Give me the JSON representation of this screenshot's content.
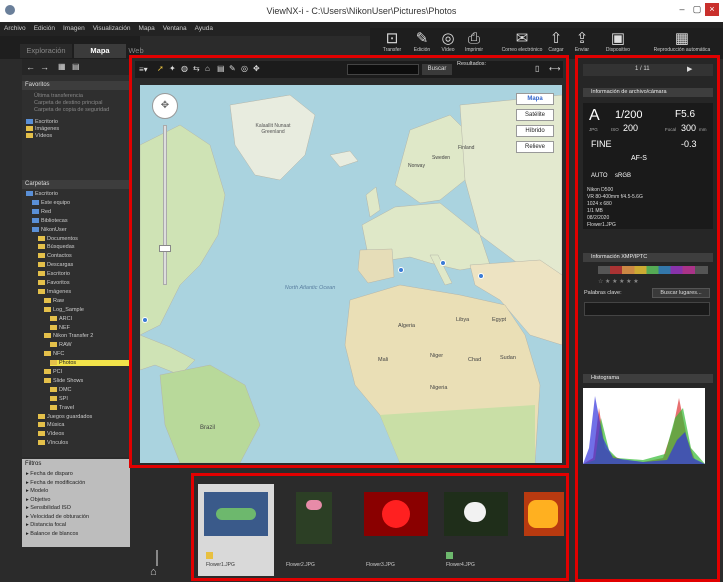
{
  "titlebar": {
    "title": "ViewNX-i - C:\\Users\\NikonUser\\Pictures\\Photos",
    "min": "–",
    "max": "▢",
    "close": "×"
  },
  "menu": [
    "Archivo",
    "Edición",
    "Imagen",
    "Visualización",
    "Mapa",
    "Ventana",
    "Ayuda"
  ],
  "tabs": {
    "explore": "Exploración",
    "map": "Mapa",
    "web": "Web"
  },
  "toolbar": [
    {
      "label": "Transfer",
      "icon": "camera-transfer-icon",
      "glyph": "⊡"
    },
    {
      "label": "Edición",
      "icon": "edit-icon",
      "glyph": "✎"
    },
    {
      "label": "Vídeo",
      "icon": "video-icon",
      "glyph": "◎"
    },
    {
      "label": "Imprimir",
      "icon": "print-icon",
      "glyph": "⎙"
    },
    {
      "label": "Correo electrónico",
      "icon": "mail-icon",
      "glyph": "✉"
    },
    {
      "label": "Cargar",
      "icon": "upload-icon",
      "glyph": "⇧"
    },
    {
      "label": "Enviar",
      "icon": "send-icon",
      "glyph": "⇪"
    },
    {
      "label": "Dispositivo",
      "icon": "device-icon",
      "glyph": "▣"
    },
    {
      "label": "Reproducción automática",
      "icon": "slideshow-icon",
      "glyph": "▦"
    }
  ],
  "left": {
    "favorites_header": "Favoritos",
    "favorites": [
      "Última transferencia",
      "Carpeta de destino principal",
      "Carpeta de copia de seguridad"
    ],
    "favorites2": [
      "Escritorio",
      "Imágenes",
      "Vídeos"
    ],
    "folders_header": "Carpetas",
    "folders": [
      {
        "label": "Escritorio",
        "indent": 0
      },
      {
        "label": "Este equipo",
        "indent": 1
      },
      {
        "label": "Red",
        "indent": 1
      },
      {
        "label": "Bibliotecas",
        "indent": 1
      },
      {
        "label": "NikonUser",
        "indent": 1
      },
      {
        "label": "Documentos",
        "indent": 2
      },
      {
        "label": "Búsquedas",
        "indent": 2
      },
      {
        "label": "Contactos",
        "indent": 2
      },
      {
        "label": "Descargas",
        "indent": 2
      },
      {
        "label": "Escritorio",
        "indent": 2
      },
      {
        "label": "Favoritos",
        "indent": 2
      },
      {
        "label": "Imágenes",
        "indent": 2
      },
      {
        "label": "Raw",
        "indent": 3
      },
      {
        "label": "Log_Sample",
        "indent": 3
      },
      {
        "label": "ARCI",
        "indent": 4
      },
      {
        "label": "NEF",
        "indent": 4
      },
      {
        "label": "Nikon Transfer 2",
        "indent": 3
      },
      {
        "label": "RAW",
        "indent": 4
      },
      {
        "label": "NFC",
        "indent": 3
      },
      {
        "label": "Photos",
        "indent": 4,
        "selected": true
      },
      {
        "label": "PCI",
        "indent": 3
      },
      {
        "label": "Slide Shows",
        "indent": 3
      },
      {
        "label": "DMC",
        "indent": 4
      },
      {
        "label": "SPI",
        "indent": 4
      },
      {
        "label": "Travel",
        "indent": 4
      },
      {
        "label": "Juegos guardados",
        "indent": 2
      },
      {
        "label": "Música",
        "indent": 2
      },
      {
        "label": "Vídeos",
        "indent": 2
      },
      {
        "label": "Vínculos",
        "indent": 2
      }
    ],
    "filters_header": "Filtros",
    "filters": [
      "Fecha de disparo",
      "Fecha de modificación",
      "Modelo",
      "Objetivo",
      "Sensibilidad ISO",
      "Velocidad de obturación",
      "Distancia focal",
      "Balance de blancos"
    ]
  },
  "map": {
    "search_button": "Buscar",
    "results_label": "Resultados:",
    "types": [
      "Mapa",
      "Satélite",
      "Híbrido",
      "Relieve"
    ],
    "labels": {
      "ocean": "North Atlantic Ocean",
      "greenland": "Kalaallit Nunaat Greenland",
      "algeria": "Algeria",
      "brazil": "Brazil",
      "libya": "Libya",
      "egypt": "Egypt",
      "sudan": "Sudan",
      "chad": "Chad",
      "niger": "Niger",
      "mali": "Mali",
      "nigeria": "Nigeria",
      "norway": "Norway",
      "sweden": "Sweden",
      "finland": "Finland"
    }
  },
  "film": [
    {
      "name": "Flower1.JPG",
      "color": "#3a5a8a",
      "accent": "#6db86d"
    },
    {
      "name": "Flower2.JPG",
      "color": "#2c3f25",
      "accent": "#e78ba8"
    },
    {
      "name": "Flower3.JPG",
      "color": "#8a0000",
      "accent": "#ff2020"
    },
    {
      "name": "Flower4.JPG",
      "color": "#1f2e1a",
      "accent": "#f2f2f2"
    },
    {
      "name": "",
      "color": "#b83a10",
      "accent": "#ffb020"
    }
  ],
  "right": {
    "page": "1 / 11",
    "info_header": "Información de archivo/cámara",
    "camera": {
      "mode": "A",
      "shutter": "1/200",
      "aperture": "F5.6",
      "iso": "200",
      "focal": "300",
      "focal_unit": "mm",
      "quality": "FINE",
      "ev": "-0.3",
      "af": "AF-S",
      "wb": "AUTO",
      "color": "sRGB",
      "format": "JPG",
      "sm": "ISO",
      "tm": "Focal"
    },
    "details": [
      "Nikon D500",
      "VR 80-400mm f/4.5-5.6G",
      "1024 x 680",
      "1/1 MB",
      "08/2/2020",
      "Flower1.JPG"
    ],
    "xmp_header": "Información XMP/IPTC",
    "keyword_label": "Palabras clave:",
    "search_place": "Buscar lugares...",
    "hist_header": "Histograma"
  }
}
